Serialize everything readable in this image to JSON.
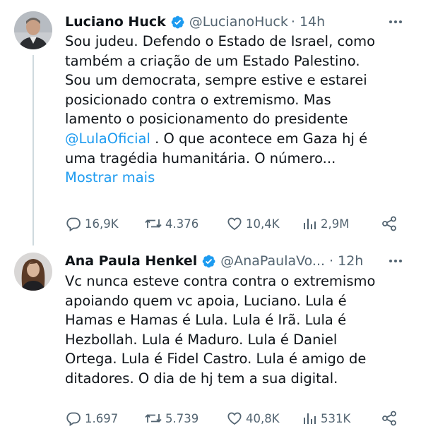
{
  "tweets": [
    {
      "name": "Luciano Huck",
      "handle": "@LucianoHuck",
      "time": "· 14h",
      "lines": [
        "Sou judeu. Defendo o Estado de Israel, como",
        "também a criação de um Estado Palestino.",
        "Sou um democrata, sempre estive e estarei",
        "posicionado contra o extremismo. Mas",
        "lamento o posicionamento do presidente"
      ],
      "mention": "@LulaOficial",
      "mention_after": " . O que acontece em Gaza hj é",
      "lines_after": [
        "uma tragédia humanitária. O número..."
      ],
      "show_more": "Mostrar mais",
      "stats": {
        "replies": "16,9K",
        "retweets": "4.376",
        "likes": "10,4K",
        "views": "2,9M"
      }
    },
    {
      "name": "Ana Paula Henkel",
      "handle": "@AnaPaulaVo...",
      "time": "· 12h",
      "lines": [
        "Vc nunca esteve contra contra o extremismo",
        "apoiando quem vc apoia, Luciano. Lula é",
        "Hamas e Hamas é Lula. Lula é Irã. Lula é",
        "Hezbollah. Lula é Maduro. Lula é Daniel",
        "Ortega. Lula é Fidel Castro. Lula é amigo de",
        "ditadores. O dia de hj tem a sua digital."
      ],
      "stats": {
        "replies": "1.697",
        "retweets": "5.739",
        "likes": "40,8K",
        "views": "531K"
      }
    }
  ],
  "colors": {
    "text": "#0f1419",
    "secondary": "#536471",
    "link": "#1d9bf0",
    "verified": "#1d9bf0",
    "thread_line": "#cfd9de"
  },
  "icons": [
    "verified-badge-icon",
    "more-options-icon",
    "reply-icon",
    "retweet-icon",
    "like-icon",
    "views-icon",
    "share-icon"
  ]
}
